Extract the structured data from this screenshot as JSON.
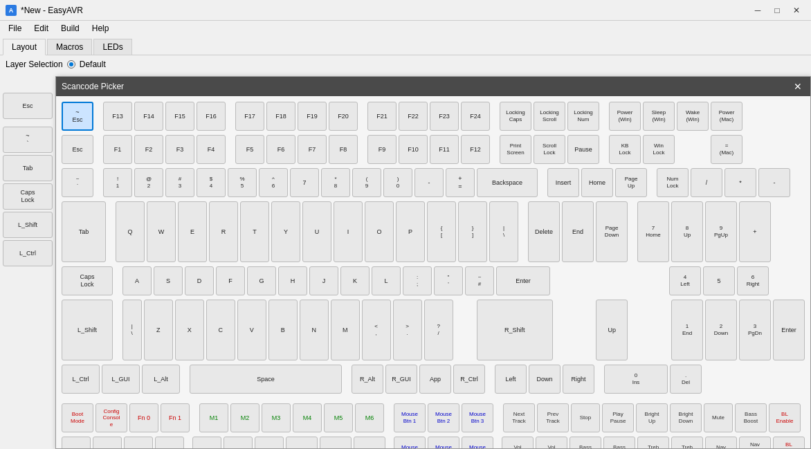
{
  "app": {
    "title": "*New - EasyAVR",
    "icon": "A"
  },
  "menu": {
    "items": [
      "File",
      "Edit",
      "Build",
      "Help"
    ]
  },
  "tabs": {
    "items": [
      "Layout",
      "Macros",
      "LEDs"
    ],
    "active": 0
  },
  "layer": {
    "label": "Layer Selection",
    "selected": "Default"
  },
  "dialog": {
    "title": "Scancode Picker",
    "close_label": "×"
  },
  "keys": {
    "selected": "Esc"
  }
}
